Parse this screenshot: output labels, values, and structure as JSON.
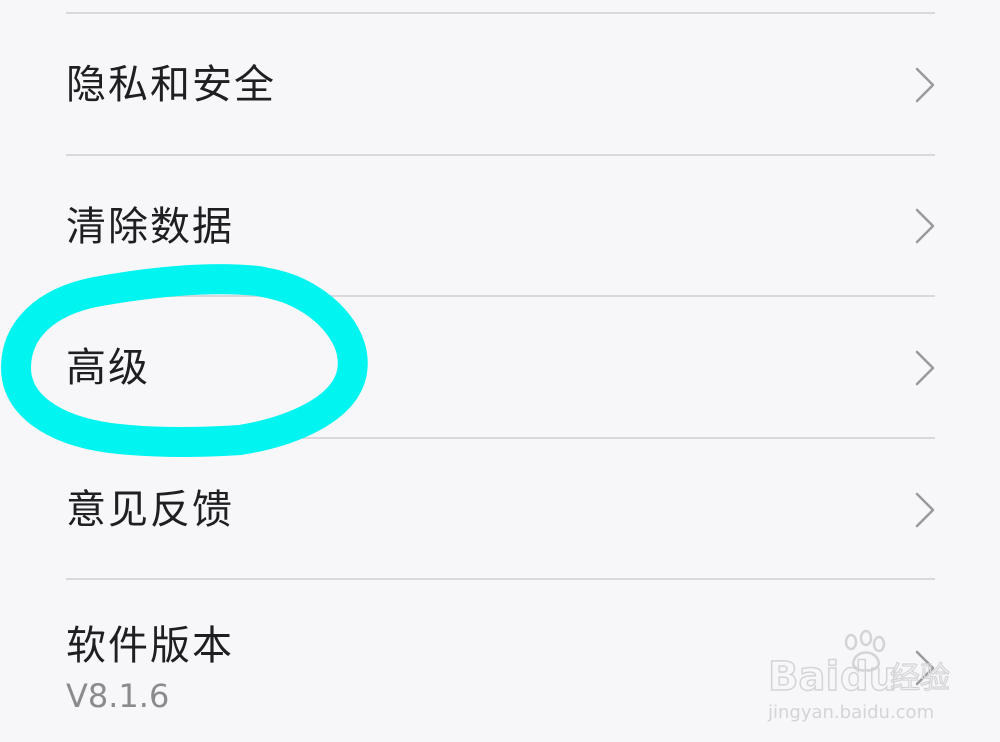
{
  "settings_list": {
    "items": [
      {
        "label": "隐私和安全",
        "sub": "",
        "chevron": "chevron-right-icon"
      },
      {
        "label": "清除数据",
        "sub": "",
        "chevron": "chevron-right-icon"
      },
      {
        "label": "高级",
        "sub": "",
        "chevron": "chevron-right-icon"
      },
      {
        "label": "意见反馈",
        "sub": "",
        "chevron": "chevron-right-icon"
      },
      {
        "label": "软件版本",
        "sub": "V8.1.6",
        "chevron": "chevron-right-icon"
      }
    ]
  },
  "annotation": {
    "color": "#00f5f0",
    "highlighted_item": "高级"
  },
  "watermark": {
    "brand": "Baidu经验",
    "url": "jingyan.baidu.com"
  },
  "colors": {
    "background": "#f7f6f8",
    "divider": "#d9d8dc",
    "text": "#1f1f21",
    "subtext": "#8b8b8f",
    "chevron": "#9a9a9e"
  }
}
